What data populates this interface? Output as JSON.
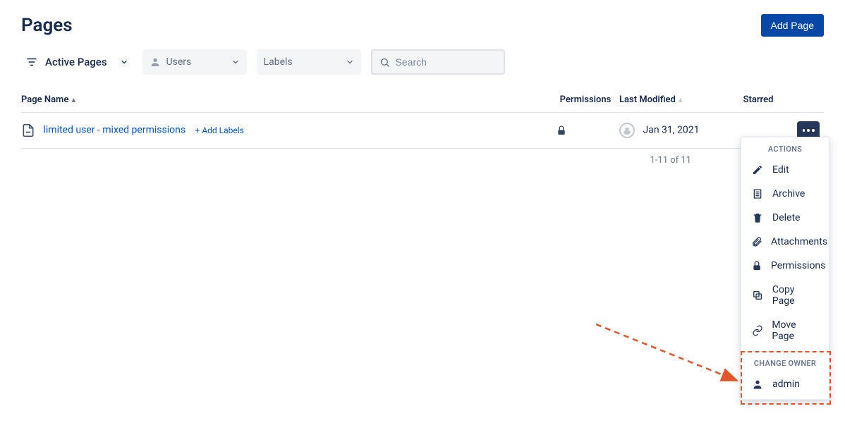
{
  "header": {
    "title": "Pages",
    "add_button": "Add Page"
  },
  "filters": {
    "scope": "Active Pages",
    "users_label": "Users",
    "labels_label": "Labels",
    "search_placeholder": "Search"
  },
  "columns": {
    "name": "Page Name",
    "permissions": "Permissions",
    "last_modified": "Last Modified",
    "starred": "Starred"
  },
  "rows": [
    {
      "title": "limited user - mixed permissions",
      "add_labels": "+ Add Labels",
      "modified": "Jan 31, 2021"
    }
  ],
  "pager": "1-11 of 11",
  "menu": {
    "section_actions": "ACTIONS",
    "edit": "Edit",
    "archive": "Archive",
    "delete": "Delete",
    "attachments": "Attachments",
    "permissions": "Permissions",
    "copy": "Copy Page",
    "move": "Move Page",
    "section_owner": "CHANGE OWNER",
    "owner": "admin"
  }
}
